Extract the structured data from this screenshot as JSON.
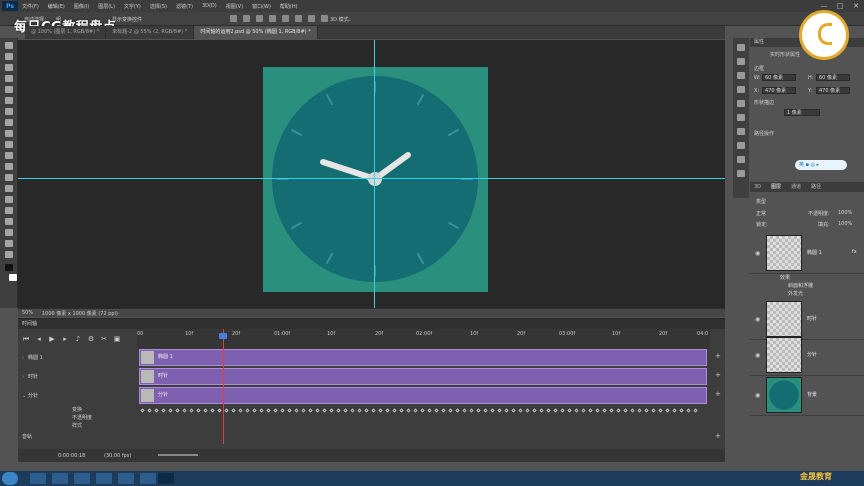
{
  "app": {
    "logo": "Ps"
  },
  "menu": [
    "文件(F)",
    "编辑(E)",
    "图像(I)",
    "图层(L)",
    "文字(Y)",
    "选择(S)",
    "滤镜(T)",
    "3D(D)",
    "视图(V)",
    "窗口(W)",
    "帮助(H)"
  ],
  "window_buttons": [
    "—",
    "□",
    "✕"
  ],
  "options": {
    "tool_label": "自动选择：",
    "tool_value": "组",
    "transform_label": "显示变换控件",
    "mode_label": "3D 模式："
  },
  "watermark": "每日CG教程盘点",
  "tabs": [
    {
      "label": "@ 100% (图层 1, RGB/8#) *",
      "active": false
    },
    {
      "label": "未标题-2 @ 55% (2, RGB/8#) *",
      "active": false
    },
    {
      "label": "时间轴的运用2.psd @ 50% (椭圆 1, RGB/8#) *",
      "active": true
    }
  ],
  "status": {
    "zoom": "50%",
    "doc_info": "1000 像素 x 1000 像素 (72 ppi)"
  },
  "timeline": {
    "title": "时间轴",
    "ruler_ticks": [
      "00",
      "10f",
      "20f",
      "01:00f",
      "10f",
      "20f",
      "02:00f",
      "10f",
      "20f",
      "03:00f",
      "10f",
      "20f",
      "04:0"
    ],
    "playhead_time": "0:00:00:18",
    "fps": "(30.00 fps)",
    "tracks": [
      {
        "name": "椭圆 1",
        "bar_label": "椭圆 1"
      },
      {
        "name": "时针",
        "bar_label": "时针"
      },
      {
        "name": "分针",
        "bar_label": "分针"
      }
    ],
    "sub_rows": [
      "变换",
      "不透明度",
      "样式"
    ],
    "audio": "音轨"
  },
  "properties": {
    "title": "属性",
    "subtitle": "实时形状属性",
    "w_label": "W:",
    "w_value": "60 像素",
    "h_label": "H:",
    "h_value": "60 像素",
    "x_label": "X:",
    "x_value": "470 像素",
    "y_label": "Y:",
    "y_value": "470 像素",
    "section_1": "边框",
    "section_2": "形状描边",
    "stroke_value": "1 像素",
    "section_3": "路径操作"
  },
  "layers": {
    "tabs": [
      "3D",
      "图层",
      "通道",
      "路径"
    ],
    "kind_label": "类型",
    "blend": "正常",
    "opacity_label": "不透明度:",
    "opacity_value": "100%",
    "lock_label": "锁定:",
    "fill_label": "填充:",
    "fill_value": "100%",
    "items": [
      {
        "name": "椭圆 1",
        "fx": "fx",
        "effects_label": "效果",
        "effects": [
          "斜面和浮雕",
          "外发光"
        ]
      },
      {
        "name": "时针"
      },
      {
        "name": "分针"
      },
      {
        "name": "背景"
      }
    ]
  },
  "ime": "英 ▪ ◎ ▸",
  "brand": "金晟教育",
  "colors": {
    "doc_bg": "#2b8f7d",
    "dial": "#146d72",
    "track": "#7e5fb0",
    "guide": "#37d2e6",
    "playhead": "#e23c3c"
  }
}
